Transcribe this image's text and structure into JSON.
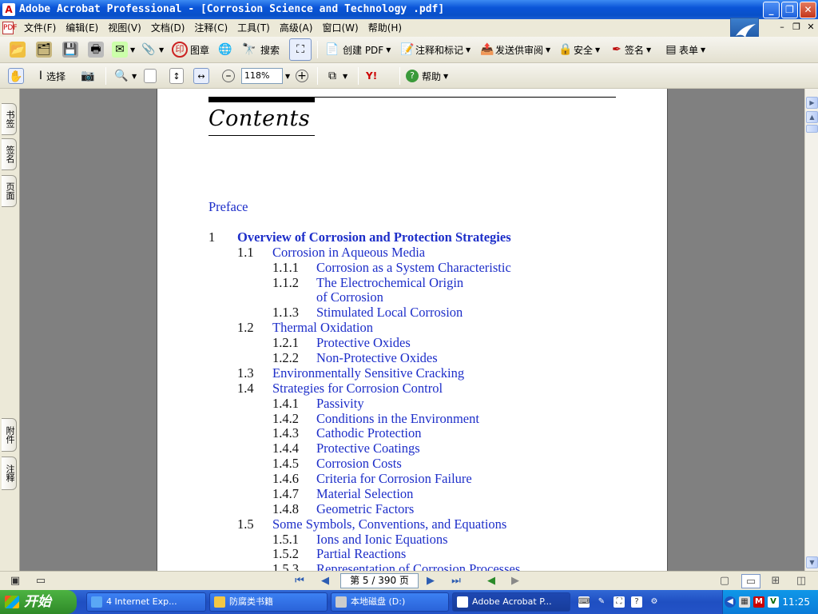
{
  "window": {
    "title": "Adobe Acrobat Professional - [Corrosion Science and Technology .pdf]",
    "minimize": "_",
    "maximize": "❐",
    "close": "✕"
  },
  "menu": {
    "items": [
      "文件(F)",
      "编辑(E)",
      "视图(V)",
      "文档(D)",
      "注释(C)",
      "工具(T)",
      "高级(A)",
      "窗口(W)",
      "帮助(H)"
    ],
    "mdi_min": "–",
    "mdi_restore": "❐",
    "mdi_close": "✕"
  },
  "toolbar1": {
    "stamp_label": "图章",
    "search_label": "搜索",
    "create_pdf_label": "创建 PDF",
    "comment_label": "注释和标记",
    "send_review_label": "发送供审阅",
    "security_label": "安全",
    "sign_label": "签名",
    "forms_label": "表单"
  },
  "toolbar2": {
    "select_label": "选择",
    "zoom_value": "118%",
    "help_label": "帮助",
    "yahoo_label": "Y!"
  },
  "side_tabs": {
    "bookmarks": "书签",
    "signatures": "签名",
    "pages": "页面",
    "attachments": "附件",
    "comments": "注释"
  },
  "document": {
    "heading": "Contents",
    "entries": [
      {
        "num": "",
        "label": "Preface",
        "level": 0
      },
      {
        "num": "1",
        "label": "Overview of Corrosion and Protection Strategies",
        "level": 1
      },
      {
        "num": "1.1",
        "label": "Corrosion in Aqueous Media",
        "level": 2
      },
      {
        "num": "1.1.1",
        "label": "Corrosion as a System Characteristic",
        "level": 3
      },
      {
        "num": "1.1.2",
        "label": "The Electrochemical Origin",
        "level": 3
      },
      {
        "num": "",
        "label": "of Corrosion",
        "level": 3
      },
      {
        "num": "1.1.3",
        "label": "Stimulated Local Corrosion",
        "level": 3
      },
      {
        "num": "1.2",
        "label": "Thermal Oxidation",
        "level": 2
      },
      {
        "num": "1.2.1",
        "label": "Protective Oxides",
        "level": 3
      },
      {
        "num": "1.2.2",
        "label": "Non-Protective Oxides",
        "level": 3
      },
      {
        "num": "1.3",
        "label": "Environmentally Sensitive Cracking",
        "level": 2
      },
      {
        "num": "1.4",
        "label": "Strategies for Corrosion Control",
        "level": 2
      },
      {
        "num": "1.4.1",
        "label": "Passivity",
        "level": 3
      },
      {
        "num": "1.4.2",
        "label": "Conditions in the Environment",
        "level": 3
      },
      {
        "num": "1.4.3",
        "label": "Cathodic Protection",
        "level": 3
      },
      {
        "num": "1.4.4",
        "label": "Protective Coatings",
        "level": 3
      },
      {
        "num": "1.4.5",
        "label": "Corrosion Costs",
        "level": 3
      },
      {
        "num": "1.4.6",
        "label": "Criteria for Corrosion Failure",
        "level": 3
      },
      {
        "num": "1.4.7",
        "label": "Material Selection",
        "level": 3
      },
      {
        "num": "1.4.8",
        "label": "Geometric Factors",
        "level": 3
      },
      {
        "num": "1.5",
        "label": "Some Symbols, Conventions, and Equations",
        "level": 2
      },
      {
        "num": "1.5.1",
        "label": "Ions and Ionic Equations",
        "level": 3
      },
      {
        "num": "1.5.2",
        "label": "Partial Reactions",
        "level": 3
      },
      {
        "num": "1.5.3",
        "label": "Representation of Corrosion Processes",
        "level": 3
      }
    ]
  },
  "navigation": {
    "page_indicator": "第 5 / 390 页"
  },
  "taskbar": {
    "start_label": "开始",
    "tasks": [
      {
        "label": "4 Internet Exp...",
        "active": false
      },
      {
        "label": "防腐类书籍",
        "active": false
      },
      {
        "label": "本地磁盘 (D:)",
        "active": false
      },
      {
        "label": "Adobe Acrobat P...",
        "active": true
      }
    ],
    "clock": "11:25"
  },
  "colors": {
    "link_blue": "#1d2ec9",
    "titlebar_blue": "#0a54d8",
    "taskbar_blue": "#2453c7"
  }
}
